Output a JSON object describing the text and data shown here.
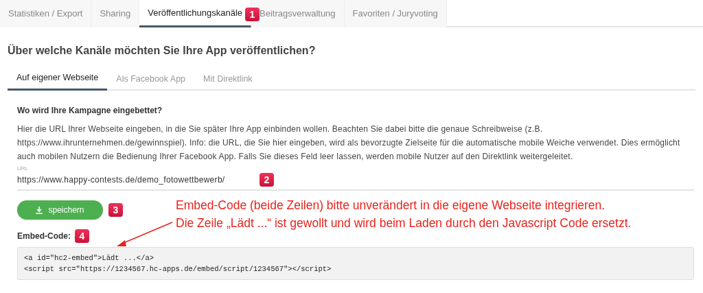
{
  "tabs": [
    {
      "label": "Statistiken / Export",
      "selected": false
    },
    {
      "label": "Sharing",
      "selected": false
    },
    {
      "label": "Veröffentlichungskanäle",
      "selected": true,
      "badge": "1"
    },
    {
      "label": "Beitragsverwaltung",
      "selected": false
    },
    {
      "label": "Favoriten / Juryvoting",
      "selected": false
    }
  ],
  "heading": "Über welche Kanäle möchten Sie Ihre App veröffentlichen?",
  "subtabs": [
    {
      "label": "Auf eigener Webseite",
      "selected": true
    },
    {
      "label": "Als Facebook App",
      "selected": false
    },
    {
      "label": "Mit Direktlink",
      "selected": false
    }
  ],
  "section_title": "Wo wird Ihre Kampagne eingebettet?",
  "description": "Hier die URL Ihrer Webseite eingeben, in die Sie später Ihre App einbinden wollen. Beachten Sie dabei bitte die genaue Schreibweise (z.B. https://www.ihrunternehmen.de/gewinnspiel). Info: die URL, die Sie hier eingeben, wird als bevorzugte Zielseite für die automatische mobile Weiche verwendet. Dies ermöglicht auch mobilen Nutzern die Bedienung Ihrer Facebook App. Falls Sie dieses Feld leer lassen, werden mobile Nutzer auf den Direktlink weitergeleitet.",
  "url_field": {
    "label": "URL",
    "value": "https://www.happy-contests.de/demo_fotowettbewerb/",
    "badge": "2"
  },
  "save_button": {
    "label": "speichern",
    "badge": "3"
  },
  "embed": {
    "label": "Embed-Code:",
    "badge": "4",
    "lines": [
      "<a id=\"hc2-embed\">Lädt ...</a>",
      "<script src=\"https://1234567.hc-apps.de/embed/script/1234567\"></script>"
    ]
  },
  "annotation": [
    "Embed-Code (beide Zeilen) bitte unverändert in die eigene Webseite integrieren.",
    "Die Zeile „Lädt ...“ ist gewollt und wird beim Laden durch den Javascript Code ersetzt."
  ]
}
